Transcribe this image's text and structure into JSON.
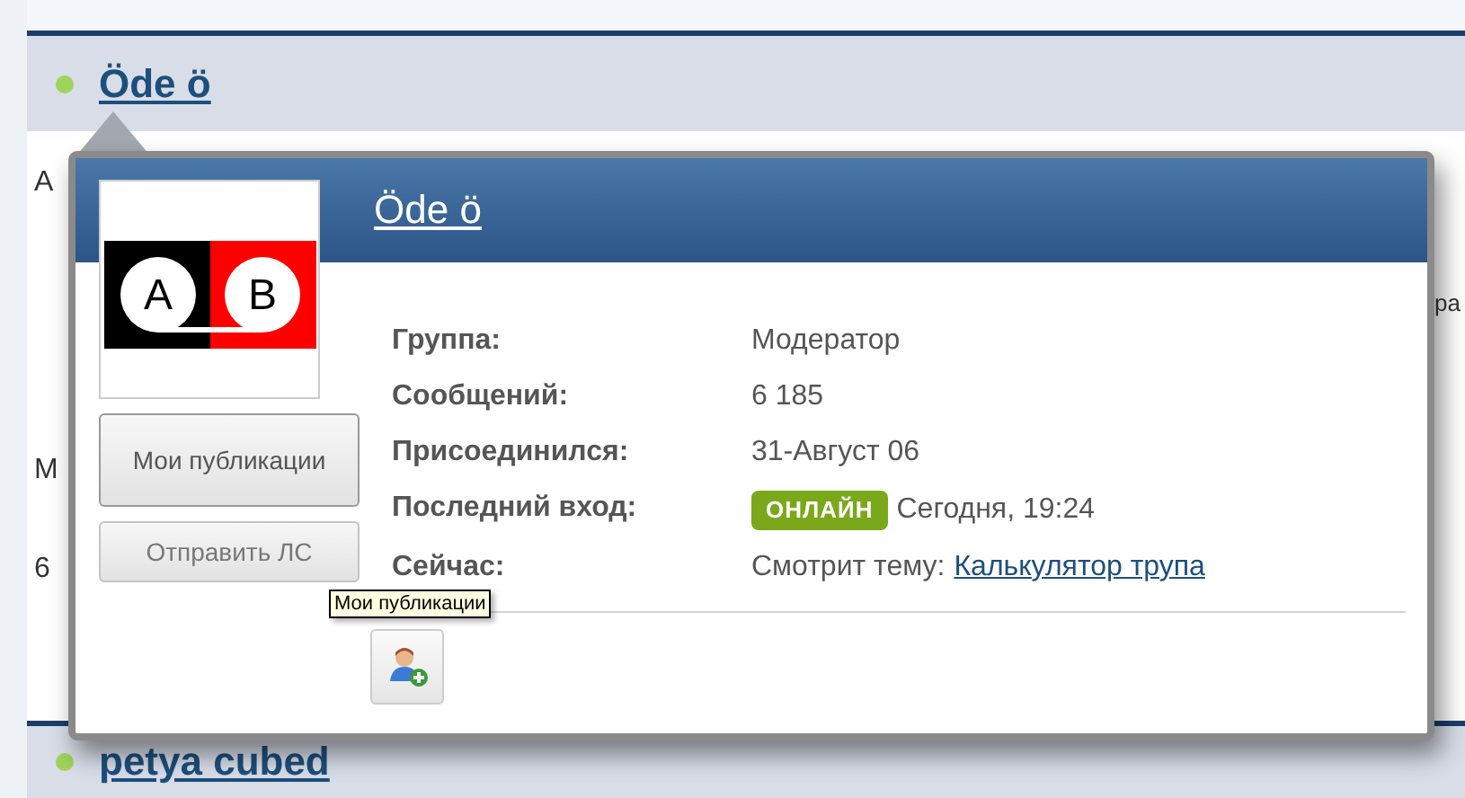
{
  "topic_header": {
    "online": true,
    "name": "Öde ö"
  },
  "behind_fragments": [
    "A",
    "М",
    "6",
    "ра"
  ],
  "avatar_letters": [
    "A",
    "B"
  ],
  "popup": {
    "title": "Öde ö",
    "buttons": [
      "Мои публикации",
      "Отправить ЛС"
    ],
    "tooltip": "Мои публикации",
    "fields": [
      {
        "kind": "text",
        "label": "Группа:",
        "value": "Модератор"
      },
      {
        "kind": "text",
        "label": "Сообщений:",
        "value": "6 185"
      },
      {
        "kind": "text",
        "label": "Присоединился:",
        "value": "31-Август 06"
      },
      {
        "kind": "status",
        "label": "Последний вход:",
        "badge": "ОНЛАЙН",
        "value": "Сегодня, 19:24"
      },
      {
        "kind": "link",
        "label": "Сейчас:",
        "value": "Смотрит тему:",
        "link": "Калькулятор трупа"
      }
    ]
  },
  "next_topic": {
    "online": true,
    "name": "petya cubed"
  }
}
